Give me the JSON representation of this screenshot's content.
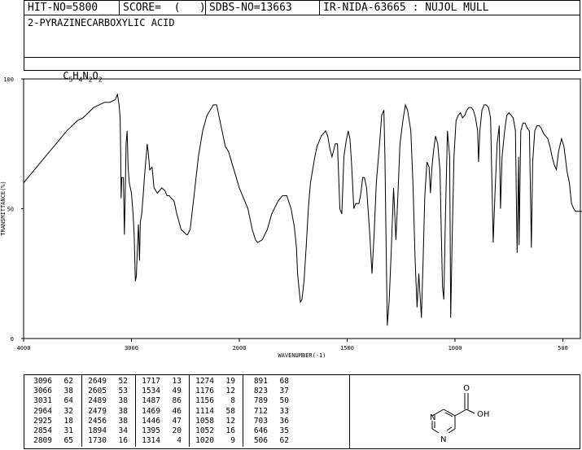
{
  "header": {
    "hit_no": "HIT-NO=5800",
    "score": "SCORE=  (   )",
    "sdbs_no": "SDBS-NO=13663",
    "ir_nida": "IR-NIDA-63665 : NUJOL MULL",
    "compound_name": "2-PYRAZINECARBOXYLIC ACID",
    "formula_parts": [
      "C",
      "5",
      "H",
      "4",
      "N",
      "2",
      "O",
      "2"
    ]
  },
  "chart_data": {
    "type": "line",
    "xlabel": "WAVENUMBER(-1)",
    "ylabel": "TRANSMITTANCE(%)",
    "xlim": [
      4000,
      400
    ],
    "ylim": [
      0,
      100
    ],
    "x_ticks": [
      "4000",
      "3000",
      "2000",
      "1500",
      "1000",
      "500"
    ],
    "y_ticks": [
      "0",
      "50",
      "100"
    ],
    "grid": false,
    "series": [
      {
        "points": [
          [
            4000,
            60
          ],
          [
            3900,
            65
          ],
          [
            3800,
            70
          ],
          [
            3700,
            75
          ],
          [
            3600,
            80
          ],
          [
            3500,
            84
          ],
          [
            3450,
            85
          ],
          [
            3400,
            87
          ],
          [
            3350,
            89
          ],
          [
            3300,
            90
          ],
          [
            3250,
            91
          ],
          [
            3200,
            91
          ],
          [
            3150,
            92
          ],
          [
            3130,
            94
          ],
          [
            3115,
            90
          ],
          [
            3105,
            85
          ],
          [
            3100,
            70
          ],
          [
            3096,
            54
          ],
          [
            3090,
            62
          ],
          [
            3075,
            62
          ],
          [
            3066,
            40
          ],
          [
            3058,
            55
          ],
          [
            3050,
            75
          ],
          [
            3040,
            80
          ],
          [
            3031,
            66
          ],
          [
            3020,
            60
          ],
          [
            3000,
            56
          ],
          [
            2985,
            48
          ],
          [
            2975,
            40
          ],
          [
            2964,
            22
          ],
          [
            2955,
            24
          ],
          [
            2945,
            35
          ],
          [
            2935,
            44
          ],
          [
            2925,
            30
          ],
          [
            2918,
            45
          ],
          [
            2905,
            48
          ],
          [
            2890,
            56
          ],
          [
            2880,
            62
          ],
          [
            2870,
            67
          ],
          [
            2860,
            72
          ],
          [
            2854,
            75
          ],
          [
            2845,
            72
          ],
          [
            2830,
            65
          ],
          [
            2809,
            66
          ],
          [
            2790,
            58
          ],
          [
            2760,
            56
          ],
          [
            2720,
            58
          ],
          [
            2690,
            57
          ],
          [
            2670,
            55
          ],
          [
            2649,
            55
          ],
          [
            2630,
            54
          ],
          [
            2605,
            53
          ],
          [
            2580,
            48
          ],
          [
            2540,
            42
          ],
          [
            2489,
            40
          ],
          [
            2479,
            40
          ],
          [
            2456,
            42
          ],
          [
            2420,
            55
          ],
          [
            2380,
            70
          ],
          [
            2340,
            80
          ],
          [
            2300,
            86
          ],
          [
            2270,
            88
          ],
          [
            2240,
            90
          ],
          [
            2210,
            90
          ],
          [
            2190,
            86
          ],
          [
            2160,
            80
          ],
          [
            2130,
            74
          ],
          [
            2100,
            72
          ],
          [
            2050,
            65
          ],
          [
            2000,
            58
          ],
          [
            1960,
            50
          ],
          [
            1940,
            42
          ],
          [
            1925,
            38
          ],
          [
            1915,
            37
          ],
          [
            1894,
            38
          ],
          [
            1870,
            42
          ],
          [
            1850,
            48
          ],
          [
            1820,
            53
          ],
          [
            1800,
            55
          ],
          [
            1780,
            55
          ],
          [
            1760,
            50
          ],
          [
            1745,
            43
          ],
          [
            1735,
            35
          ],
          [
            1730,
            25
          ],
          [
            1717,
            14
          ],
          [
            1710,
            15
          ],
          [
            1700,
            22
          ],
          [
            1690,
            35
          ],
          [
            1680,
            50
          ],
          [
            1670,
            60
          ],
          [
            1660,
            65
          ],
          [
            1650,
            70
          ],
          [
            1640,
            74
          ],
          [
            1630,
            76
          ],
          [
            1620,
            78
          ],
          [
            1600,
            80
          ],
          [
            1590,
            78
          ],
          [
            1580,
            73
          ],
          [
            1570,
            70
          ],
          [
            1555,
            75
          ],
          [
            1545,
            75
          ],
          [
            1534,
            50
          ],
          [
            1525,
            48
          ],
          [
            1515,
            70
          ],
          [
            1505,
            76
          ],
          [
            1495,
            80
          ],
          [
            1487,
            77
          ],
          [
            1480,
            68
          ],
          [
            1469,
            50
          ],
          [
            1460,
            52
          ],
          [
            1446,
            52
          ],
          [
            1438,
            55
          ],
          [
            1428,
            62
          ],
          [
            1420,
            62
          ],
          [
            1410,
            58
          ],
          [
            1395,
            40
          ],
          [
            1385,
            25
          ],
          [
            1375,
            40
          ],
          [
            1365,
            60
          ],
          [
            1350,
            75
          ],
          [
            1340,
            86
          ],
          [
            1330,
            88
          ],
          [
            1325,
            70
          ],
          [
            1320,
            40
          ],
          [
            1314,
            5
          ],
          [
            1305,
            15
          ],
          [
            1295,
            35
          ],
          [
            1285,
            58
          ],
          [
            1274,
            38
          ],
          [
            1265,
            55
          ],
          [
            1255,
            75
          ],
          [
            1240,
            85
          ],
          [
            1230,
            90
          ],
          [
            1220,
            88
          ],
          [
            1205,
            80
          ],
          [
            1195,
            60
          ],
          [
            1185,
            30
          ],
          [
            1176,
            12
          ],
          [
            1168,
            25
          ],
          [
            1156,
            8
          ],
          [
            1148,
            30
          ],
          [
            1140,
            55
          ],
          [
            1130,
            68
          ],
          [
            1120,
            66
          ],
          [
            1114,
            56
          ],
          [
            1108,
            65
          ],
          [
            1100,
            72
          ],
          [
            1090,
            78
          ],
          [
            1080,
            75
          ],
          [
            1070,
            65
          ],
          [
            1058,
            20
          ],
          [
            1052,
            15
          ],
          [
            1045,
            45
          ],
          [
            1035,
            80
          ],
          [
            1025,
            70
          ],
          [
            1020,
            8
          ],
          [
            1014,
            35
          ],
          [
            1005,
            70
          ],
          [
            995,
            84
          ],
          [
            985,
            86
          ],
          [
            975,
            87
          ],
          [
            965,
            85
          ],
          [
            955,
            86
          ],
          [
            945,
            88
          ],
          [
            935,
            89
          ],
          [
            925,
            89
          ],
          [
            915,
            88
          ],
          [
            905,
            85
          ],
          [
            895,
            80
          ],
          [
            891,
            68
          ],
          [
            885,
            80
          ],
          [
            875,
            88
          ],
          [
            865,
            90
          ],
          [
            855,
            90
          ],
          [
            845,
            89
          ],
          [
            835,
            85
          ],
          [
            823,
            37
          ],
          [
            815,
            55
          ],
          [
            805,
            75
          ],
          [
            795,
            82
          ],
          [
            789,
            50
          ],
          [
            782,
            70
          ],
          [
            770,
            80
          ],
          [
            760,
            86
          ],
          [
            750,
            87
          ],
          [
            740,
            86
          ],
          [
            730,
            85
          ],
          [
            720,
            80
          ],
          [
            712,
            33
          ],
          [
            705,
            70
          ],
          [
            703,
            36
          ],
          [
            695,
            80
          ],
          [
            685,
            83
          ],
          [
            675,
            83
          ],
          [
            665,
            81
          ],
          [
            655,
            80
          ],
          [
            646,
            35
          ],
          [
            640,
            68
          ],
          [
            630,
            80
          ],
          [
            620,
            82
          ],
          [
            610,
            82
          ],
          [
            600,
            81
          ],
          [
            590,
            79
          ],
          [
            580,
            78
          ],
          [
            570,
            77
          ],
          [
            560,
            74
          ],
          [
            550,
            70
          ],
          [
            540,
            67
          ],
          [
            530,
            65
          ],
          [
            520,
            72
          ],
          [
            506,
            77
          ],
          [
            495,
            74
          ],
          [
            480,
            64
          ],
          [
            470,
            60
          ],
          [
            460,
            52
          ],
          [
            450,
            50
          ],
          [
            440,
            49
          ],
          [
            425,
            49
          ],
          [
            410,
            49
          ],
          [
            400,
            50
          ]
        ]
      }
    ]
  },
  "peak_table": {
    "columns": [
      [
        [
          "3096",
          "62"
        ],
        [
          "3066",
          "38"
        ],
        [
          "3031",
          "64"
        ],
        [
          "2964",
          "32"
        ],
        [
          "2925",
          "18"
        ],
        [
          "2854",
          "31"
        ],
        [
          "2809",
          "65"
        ]
      ],
      [
        [
          "2649",
          "52"
        ],
        [
          "2605",
          "53"
        ],
        [
          "2489",
          "38"
        ],
        [
          "2479",
          "38"
        ],
        [
          "2456",
          "38"
        ],
        [
          "1894",
          "34"
        ],
        [
          "1730",
          "16"
        ]
      ],
      [
        [
          "1717",
          "13"
        ],
        [
          "1534",
          "49"
        ],
        [
          "1487",
          "86"
        ],
        [
          "1469",
          "46"
        ],
        [
          "1446",
          "47"
        ],
        [
          "1395",
          "20"
        ],
        [
          "1314",
          "4"
        ]
      ],
      [
        [
          "1274",
          "19"
        ],
        [
          "1176",
          "12"
        ],
        [
          "1156",
          "8"
        ],
        [
          "1114",
          "58"
        ],
        [
          "1058",
          "12"
        ],
        [
          "1052",
          "16"
        ],
        [
          "1020",
          "9"
        ]
      ],
      [
        [
          "891",
          "68"
        ],
        [
          "823",
          "37"
        ],
        [
          "789",
          "50"
        ],
        [
          "712",
          "33"
        ],
        [
          "703",
          "36"
        ],
        [
          "646",
          "35"
        ],
        [
          "506",
          "62"
        ]
      ]
    ]
  },
  "structure": {
    "atom_O": "O",
    "atom_OH": "OH",
    "atom_N1": "N",
    "atom_N2": "N"
  }
}
